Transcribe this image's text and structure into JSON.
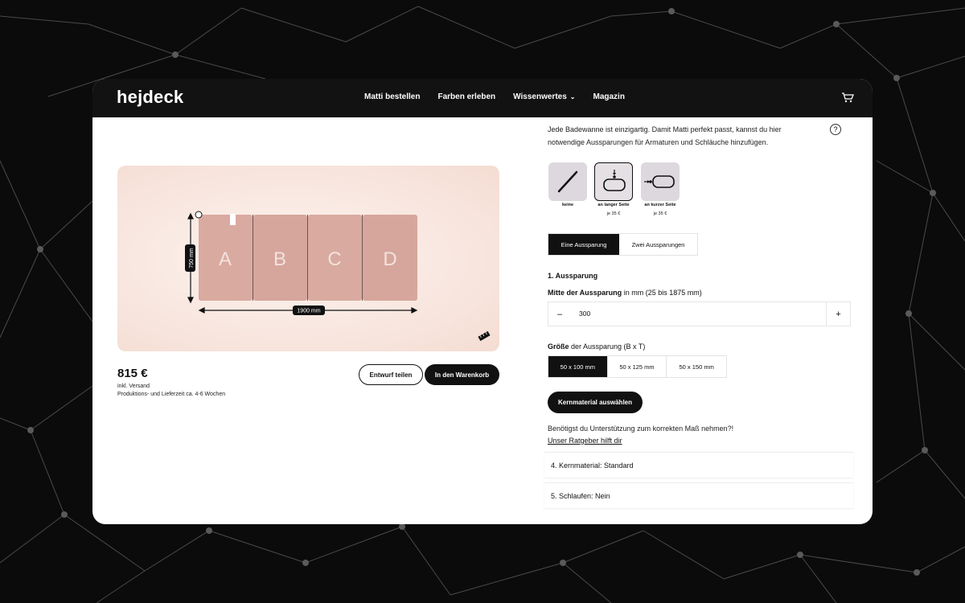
{
  "header": {
    "logo": "hejdeck",
    "nav": [
      {
        "label": "Matti bestellen"
      },
      {
        "label": "Farben erleben"
      },
      {
        "label": "Wissenwertes"
      },
      {
        "label": "Magazin"
      }
    ]
  },
  "preview": {
    "panels": [
      "A",
      "B",
      "C",
      "D"
    ],
    "width_label": "1900 mm",
    "height_label": "750 mm"
  },
  "product": {
    "price": "815 €",
    "shipping": "inkl. Versand",
    "lead_time": "Produktions- und Lieferzeit ca. 4-6 Wochen",
    "share_label": "Entwurf teilen",
    "cart_label": "In den Warenkorb"
  },
  "config": {
    "intro": "Jede Badewanne ist einzigartig. Damit Matti perfekt passt, kannst du hier notwendige Aussparungen für Armaturen und Schläuche hinzufügen.",
    "help": "?",
    "options": [
      {
        "label": "keine",
        "price": ""
      },
      {
        "label": "an langer Seite",
        "price": "je 35 €"
      },
      {
        "label": "an kurzer Seite",
        "price": "je 35 €"
      }
    ],
    "count_tabs": [
      "Eine Aussparung",
      "Zwei Aussparungen"
    ],
    "section_title": "1. Aussparung",
    "position": {
      "label_bold": "Mitte der Aussparung",
      "label_rest": " in mm (25 bis 1875 mm)",
      "minus": "–",
      "value": "300",
      "plus": "+"
    },
    "size": {
      "label_bold": "Größe",
      "label_rest": " der Aussparung (B x T)",
      "options": [
        "50 x 100 mm",
        "50 x 125 mm",
        "50 x 150 mm"
      ]
    },
    "kern_button": "Kernmaterial auswählen",
    "support_text": "Benötigst du Unterstützung zum korrekten Maß nehmen?!",
    "support_link": "Unser Ratgeber hilft dir",
    "accordions": [
      "4. Kernmaterial: Standard",
      "5. Schlaufen: Nein"
    ]
  },
  "colors": {
    "dark": "#111111",
    "mat": "#d9aaa0",
    "preview_bg": "#f7e4dc"
  }
}
